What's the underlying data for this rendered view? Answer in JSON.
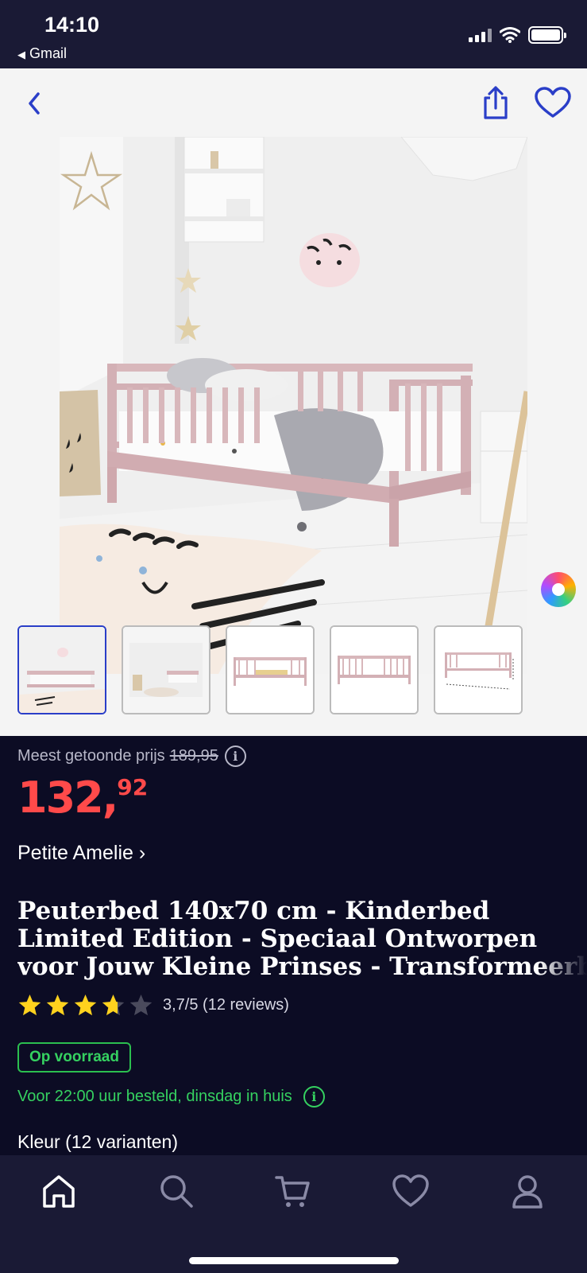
{
  "status_bar": {
    "time": "14:10",
    "back_app": "Gmail"
  },
  "product": {
    "orig_price_label": "Meest getoonde prijs",
    "orig_price": "189,95",
    "price_int": "132,",
    "price_dec": "92",
    "brand": "Petite Amelie ›",
    "title_lines": [
      "Peuterbed 140x70 cm - Kinderbed",
      "Limited Edition - Speciaal Ontworpen",
      "voor Jouw Kleine Prinses - Transformeerbaar"
    ],
    "rating_value": 3.7,
    "rating_max": 5,
    "rating_text": "3,7/5 (12 reviews)",
    "stock_label": "Op voorraad",
    "delivery_text": "Voor 22:00 uur besteld, dinsdag in huis",
    "variant_label": "Kleur (12 varianten)"
  },
  "thumbnails": {
    "count": 5,
    "selected_index": 0
  },
  "colors": {
    "accent_blue": "#2a3ec8",
    "price_red": "#ff4a4a",
    "stock_green": "#35d160",
    "star_yellow": "#ffd21e",
    "background": "#0c0c24"
  },
  "icons": {
    "back": "chevron-left-icon",
    "share": "share-icon",
    "wishlist": "heart-icon",
    "color_picker": "color-wheel-icon",
    "info": "info-icon",
    "tabs": [
      "home-icon",
      "search-icon",
      "cart-icon",
      "heart-icon",
      "account-icon"
    ]
  }
}
